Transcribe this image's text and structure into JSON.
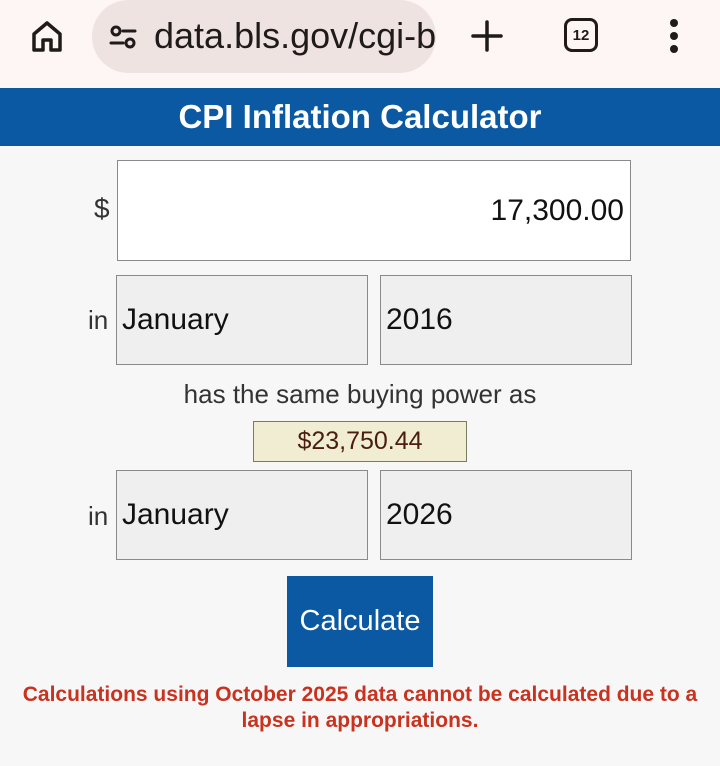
{
  "browser": {
    "url": "data.bls.gov/cgi-b",
    "tab_count": "12",
    "icons": [
      "home-icon",
      "site-settings-icon",
      "plus-icon",
      "tab-switcher-icon",
      "more-vert-icon"
    ]
  },
  "page": {
    "title": "CPI Inflation Calculator",
    "currency_symbol": "$",
    "amount_value": "17,300.00",
    "from": {
      "in_label": "in",
      "month": "January",
      "year": "2016"
    },
    "same_power_text": "has the same buying power as",
    "result": "$23,750.44",
    "to": {
      "in_label": "in",
      "month": "January",
      "year": "2026"
    },
    "calculate_label": "Calculate",
    "error_message": "Calculations using October 2025 data cannot be calculated due to a lapse in appropriations."
  },
  "colors": {
    "brand_blue": "#0b58a3",
    "error_red": "#c8321f",
    "result_bg": "#f1edd2"
  }
}
